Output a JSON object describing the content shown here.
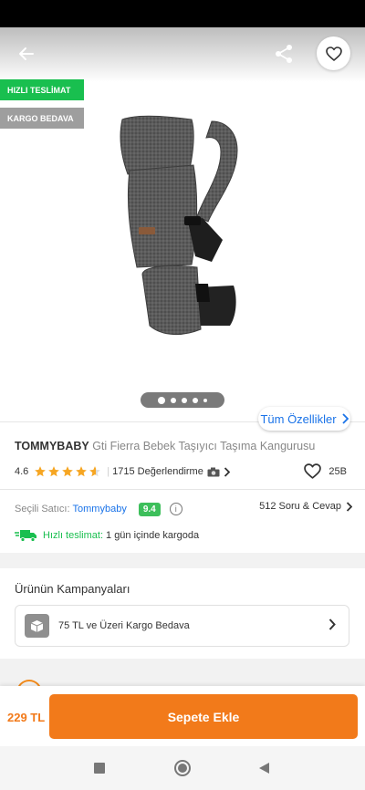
{
  "header": {
    "back_icon": "arrow-left-icon",
    "share_icon": "share-icon",
    "favorite_icon": "heart-icon"
  },
  "badges": {
    "fast_delivery": "HIZLI TESLİMAT",
    "free_cargo": "KARGO BEDAVA"
  },
  "gallery": {
    "dot_count": 5,
    "active_index": 0
  },
  "all_features_label": "Tüm Özellikler",
  "product": {
    "brand": "TOMMYBABY",
    "name": "Gti Fierra Bebek Taşıyıcı Taşıma Kangurusu",
    "rating": "4.6",
    "rating_value": 4.6,
    "reviews_label": "1715 Değerlendirme",
    "likes": "25B",
    "price": "229 TL"
  },
  "seller": {
    "label": "Seçili Satıcı:",
    "name": "Tommybaby",
    "score": "9.4",
    "qa_label": "512 Soru & Cevap"
  },
  "delivery": {
    "label": "Hızlı teslimat:",
    "text": "1 gün içinde kargoda"
  },
  "campaigns": {
    "title": "Ürünün Kampanyaları",
    "items": [
      {
        "label": "75 TL ve Üzeri Kargo Bedava"
      }
    ]
  },
  "cart": {
    "button_label": "Sepete Ekle"
  },
  "colors": {
    "accent": "#f27a1a",
    "link": "#1a73e8",
    "green": "#19bf4f",
    "star": "#f6a623"
  }
}
